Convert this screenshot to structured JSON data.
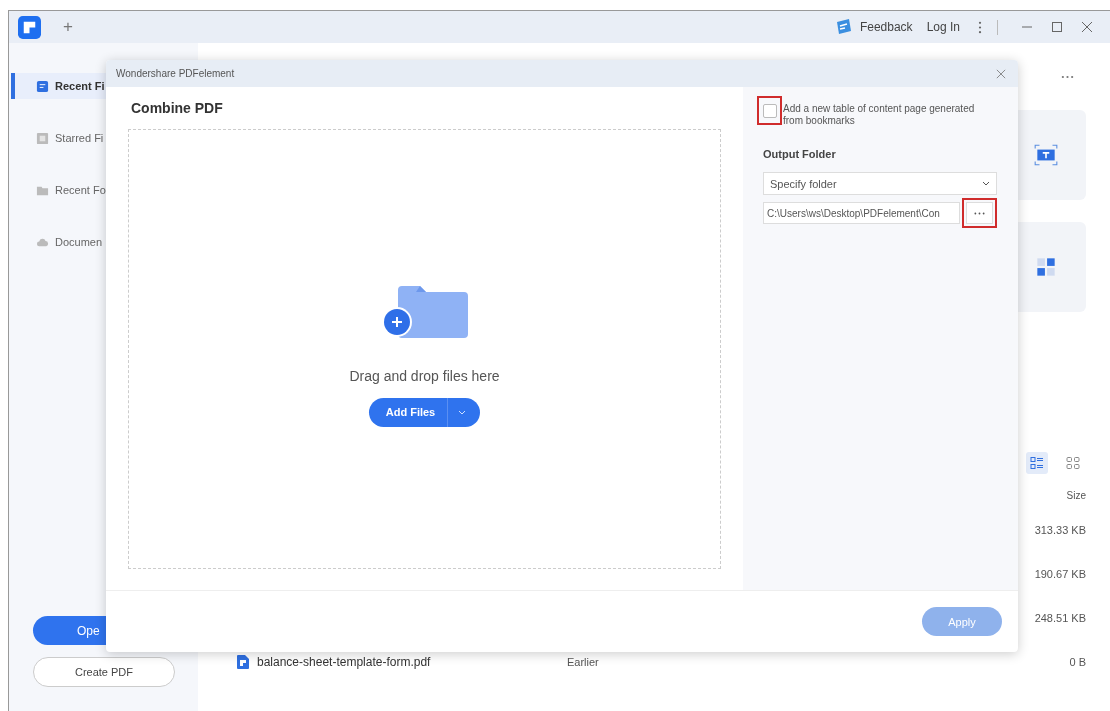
{
  "app_bar": {
    "new_tab": "+",
    "feedback": "Feedback",
    "login": "Log In"
  },
  "sidebar": {
    "items": [
      {
        "label": "Recent Fi",
        "selected": true
      },
      {
        "label": "Starred Fi",
        "selected": false
      },
      {
        "label": "Recent Fo",
        "selected": false
      },
      {
        "label": "Documen",
        "selected": false
      }
    ],
    "open_button": "Ope",
    "create_button": "Create PDF"
  },
  "main": {
    "view_modes": [
      {
        "kind": "list",
        "selected": true
      },
      {
        "kind": "grid",
        "selected": false
      }
    ],
    "size_header": "Size",
    "files": [
      {
        "size": "313.33 KB"
      },
      {
        "size": "190.67 KB"
      },
      {
        "size": "248.51 KB"
      },
      {
        "name": "balance-sheet-template-form.pdf",
        "date": "Earlier",
        "size": "0 B"
      }
    ]
  },
  "dialog": {
    "title": "Wondershare PDFelement",
    "heading": "Combine PDF",
    "drop_hint": "Drag and drop files here",
    "add_button": "Add Files",
    "toc_option": {
      "label": "Add a new table of content page generated from bookmarks",
      "checked": false
    },
    "output_label": "Output Folder",
    "folder_select": "Specify folder",
    "path": "C:\\Users\\ws\\Desktop\\PDFelement\\Con",
    "apply_button": {
      "label": "Apply",
      "disabled": true
    }
  }
}
